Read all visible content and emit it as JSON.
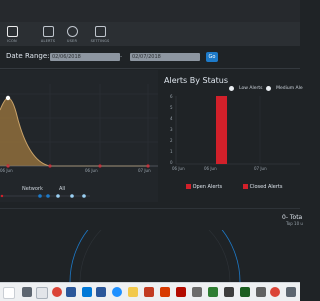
{
  "nav": {
    "items": [
      {
        "label": "ICON"
      },
      {
        "label": "ALERTS"
      },
      {
        "label": "USER"
      },
      {
        "label": "SETTINGS"
      }
    ]
  },
  "date_filter": {
    "label": "Date Range:",
    "from_value": "02/06/2018",
    "to_value": "02/07/2018",
    "separator": "-",
    "go_label": "Go"
  },
  "left_chart": {
    "x_ticks": [
      "06 Jun",
      "06 Jun",
      "07 Jun"
    ],
    "filters": [
      "Network",
      "All"
    ]
  },
  "status_chart": {
    "title": "Alerts By Status",
    "legend": [
      {
        "label": "Low Alerts"
      },
      {
        "label": "Medium Ale"
      }
    ],
    "y_ticks": [
      "6",
      "5",
      "4",
      "3",
      "2",
      "1",
      "0"
    ],
    "x_ticks": [
      "06 Jun",
      "06 Jun",
      "07 Jun"
    ],
    "bottom_legend": [
      {
        "label": "Open Alerts",
        "color": "#d2202a"
      },
      {
        "label": "Closed Alerts",
        "color": "#d2202a"
      }
    ]
  },
  "right_meta": {
    "total_label": "0- Tota",
    "sub_label": "Top 10 u"
  },
  "colors": {
    "accent_blue": "#1d7ac9",
    "bar_red": "#d2202a",
    "area_fill": "#8a6a3b"
  }
}
